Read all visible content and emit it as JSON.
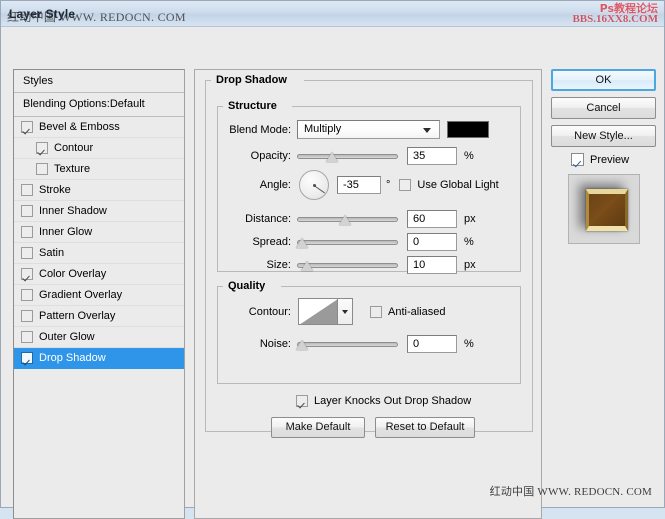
{
  "window": {
    "title": "Layer Style",
    "watermark_title_overlay": "红动中国 WWW. REDOCN. COM",
    "watermark_topright_line1": "Ps教程论坛",
    "watermark_topright_line2": "BBS.16XX8.COM",
    "watermark_bottom": "红动中国  WWW. REDOCN. COM"
  },
  "styles_panel": {
    "header": "Styles",
    "blending_options": "Blending Options:Default",
    "items": [
      {
        "label": "Bevel & Emboss",
        "checked": true,
        "indent": false,
        "selected": false
      },
      {
        "label": "Contour",
        "checked": true,
        "indent": true,
        "selected": false
      },
      {
        "label": "Texture",
        "checked": false,
        "indent": true,
        "selected": false
      },
      {
        "label": "Stroke",
        "checked": false,
        "indent": false,
        "selected": false
      },
      {
        "label": "Inner Shadow",
        "checked": false,
        "indent": false,
        "selected": false
      },
      {
        "label": "Inner Glow",
        "checked": false,
        "indent": false,
        "selected": false
      },
      {
        "label": "Satin",
        "checked": false,
        "indent": false,
        "selected": false
      },
      {
        "label": "Color Overlay",
        "checked": true,
        "indent": false,
        "selected": false
      },
      {
        "label": "Gradient Overlay",
        "checked": false,
        "indent": false,
        "selected": false
      },
      {
        "label": "Pattern Overlay",
        "checked": false,
        "indent": false,
        "selected": false
      },
      {
        "label": "Outer Glow",
        "checked": false,
        "indent": false,
        "selected": false
      },
      {
        "label": "Drop Shadow",
        "checked": true,
        "indent": false,
        "selected": true
      }
    ]
  },
  "effect": {
    "title": "Drop Shadow",
    "structure": {
      "title": "Structure",
      "blend_mode_label": "Blend Mode:",
      "blend_mode_value": "Multiply",
      "shadow_color": "#000000",
      "opacity_label": "Opacity:",
      "opacity_value": "35",
      "opacity_unit": "%",
      "angle_label": "Angle:",
      "angle_value": "-35",
      "angle_unit": "°",
      "use_global_light_label": "Use Global Light",
      "use_global_light_checked": false,
      "distance_label": "Distance:",
      "distance_value": "60",
      "distance_unit": "px",
      "spread_label": "Spread:",
      "spread_value": "0",
      "spread_unit": "%",
      "size_label": "Size:",
      "size_value": "10",
      "size_unit": "px"
    },
    "quality": {
      "title": "Quality",
      "contour_label": "Contour:",
      "anti_aliased_label": "Anti-aliased",
      "anti_aliased_checked": false,
      "noise_label": "Noise:",
      "noise_value": "0",
      "noise_unit": "%"
    },
    "layer_knocks_out_label": "Layer Knocks Out Drop Shadow",
    "layer_knocks_out_checked": true,
    "make_default_label": "Make Default",
    "reset_to_default_label": "Reset to Default"
  },
  "right_panel": {
    "ok_label": "OK",
    "cancel_label": "Cancel",
    "new_style_label": "New Style...",
    "preview_label": "Preview",
    "preview_checked": true
  },
  "colors": {
    "accent_selection": "#2e95e8",
    "dialog_bg": "#ebebeb",
    "titlebar": "#cddcec"
  }
}
